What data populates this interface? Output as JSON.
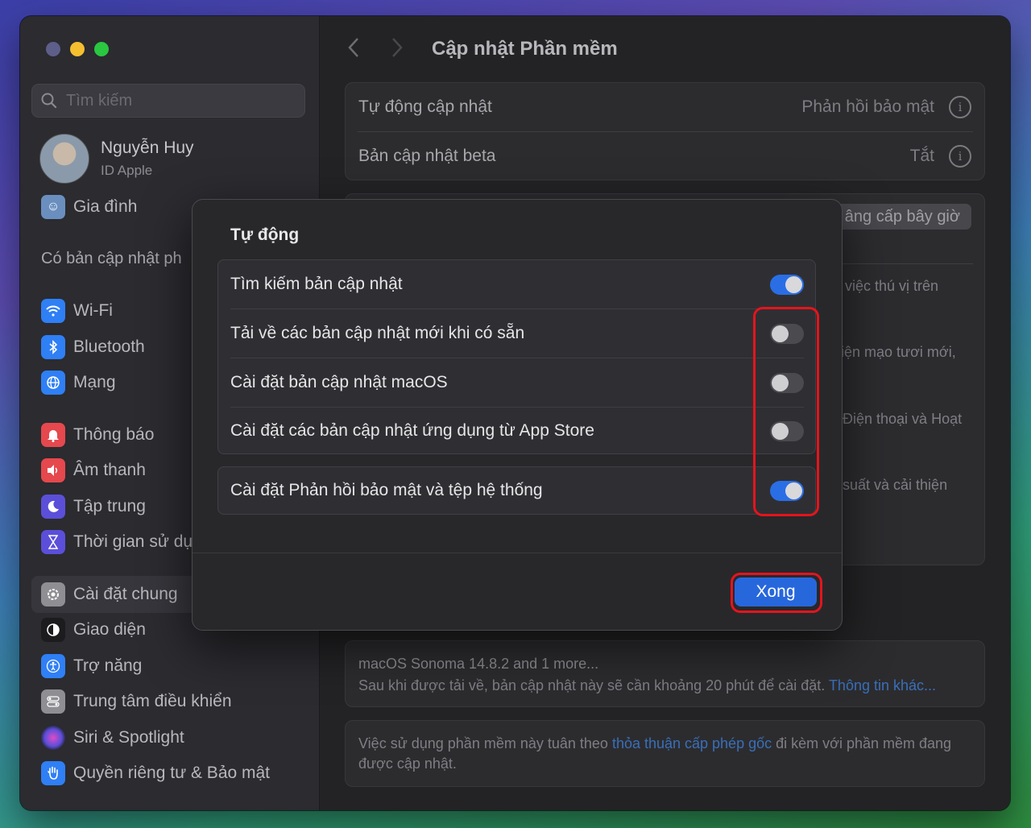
{
  "sidebar": {
    "search_placeholder": "Tìm kiếm",
    "profile_name": "Nguyễn Huy",
    "profile_sub": "ID Apple",
    "family": "Gia đình",
    "update_heading": "Có bản cập nhật ph",
    "items": [
      {
        "label": "Wi-Fi",
        "icon": "wifi-icon",
        "color": "#2f7ff5"
      },
      {
        "label": "Bluetooth",
        "icon": "bluetooth-icon",
        "color": "#2f7ff5"
      },
      {
        "label": "Mạng",
        "icon": "globe-icon",
        "color": "#2f7ff5"
      },
      {
        "label": "Thông báo",
        "icon": "bell-icon",
        "color": "#e5484d"
      },
      {
        "label": "Âm thanh",
        "icon": "speaker-icon",
        "color": "#e5484d"
      },
      {
        "label": "Tập trung",
        "icon": "moon-icon",
        "color": "#5b4fd9"
      },
      {
        "label": "Thời gian sử dụ",
        "icon": "hourglass-icon",
        "color": "#5b4fd9"
      },
      {
        "label": "Cài đặt chung",
        "icon": "gear-icon",
        "color": "#8e8e93"
      },
      {
        "label": "Giao diện",
        "icon": "appearance-icon",
        "color": "#1c1c1e"
      },
      {
        "label": "Trợ năng",
        "icon": "accessibility-icon",
        "color": "#2f7ff5"
      },
      {
        "label": "Trung tâm điều khiển",
        "icon": "control-center-icon",
        "color": "#8e8e93"
      },
      {
        "label": "Siri & Spotlight",
        "icon": "siri-icon",
        "color": "#7a4fd9"
      },
      {
        "label": "Quyền riêng tư & Bảo mật",
        "icon": "hand-icon",
        "color": "#2f7ff5"
      }
    ]
  },
  "main": {
    "title": "Cập nhật Phần mềm",
    "auto_update_label": "Tự động cập nhật",
    "auto_update_value": "Phản hồi bảo mật",
    "beta_label": "Bản cập nhật beta",
    "beta_value": "Tắt",
    "upgrade_button": "âng cấp bây giờ",
    "bg_line1": "việc thú vị trên",
    "bg_line2": "iện mạo tươi mới,",
    "bg_line3": "Điện thoại và Hoạt",
    "bg_line4": "suất và cải thiện",
    "update_name": "macOS Sonoma 14.8.2 and 1 more...",
    "update_desc": "Sau khi được tải về, bản cập nhật này sẽ cần khoảng 20 phút để cài đặt.",
    "update_link": "Thông tin khác...",
    "license_pre": "Việc sử dụng phần mềm này tuân theo",
    "license_link": "thỏa thuận cấp phép gốc",
    "license_post": "đi kèm với phần mềm đang",
    "license_line2": "được cập nhật."
  },
  "modal": {
    "title": "Tự động",
    "options": [
      {
        "label": "Tìm kiếm bản cập nhật",
        "on": true
      },
      {
        "label": "Tải về các bản cập nhật mới khi có sẵn",
        "on": false
      },
      {
        "label": "Cài đặt bản cập nhật macOS",
        "on": false
      },
      {
        "label": "Cài đặt các bản cập nhật ứng dụng từ App Store",
        "on": false
      },
      {
        "label": "Cài đặt Phản hồi bảo mật và tệp hệ thống",
        "on": true
      }
    ],
    "done_button": "Xong"
  }
}
